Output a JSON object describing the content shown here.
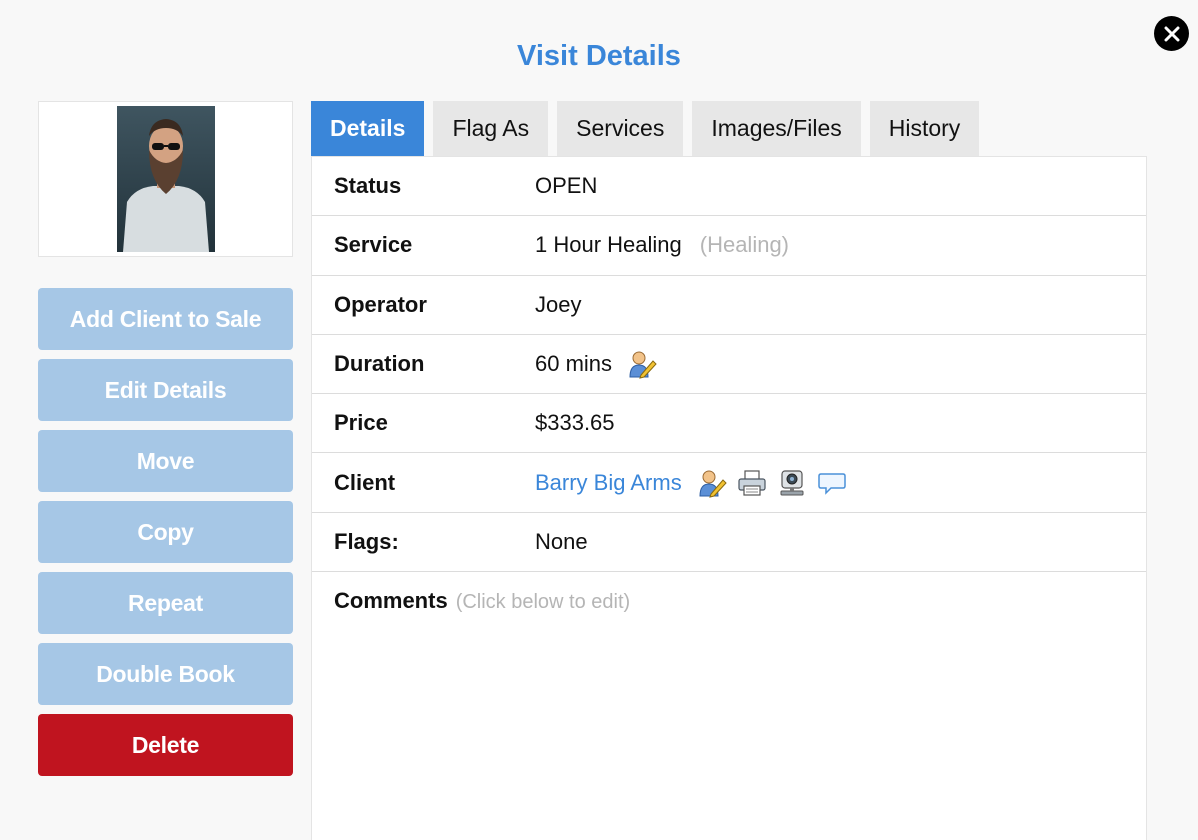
{
  "modal": {
    "title": "Visit Details",
    "close_icon": "close-icon"
  },
  "client_photo": {
    "icon": "client-photo"
  },
  "actions": {
    "add_client_to_sale": "Add Client to Sale",
    "edit_details": "Edit Details",
    "move": "Move",
    "copy": "Copy",
    "repeat": "Repeat",
    "double_book": "Double Book",
    "delete": "Delete"
  },
  "colors": {
    "accent": "#3a86d9",
    "action_button": "#a6c7e6",
    "delete_button": "#c0141f"
  },
  "tabs": [
    {
      "label": "Details",
      "active": true
    },
    {
      "label": "Flag As",
      "active": false
    },
    {
      "label": "Services",
      "active": false
    },
    {
      "label": "Images/Files",
      "active": false
    },
    {
      "label": "History",
      "active": false
    }
  ],
  "details": {
    "status": {
      "label": "Status",
      "value": "OPEN"
    },
    "service": {
      "label": "Service",
      "value": "1 Hour Healing",
      "category": "(Healing)"
    },
    "operator": {
      "label": "Operator",
      "value": "Joey"
    },
    "duration": {
      "label": "Duration",
      "value": "60 mins",
      "icon": "edit-user-icon"
    },
    "price": {
      "label": "Price",
      "value": "$333.65"
    },
    "client": {
      "label": "Client",
      "value": "Barry Big Arms",
      "icons": [
        "edit-user-icon",
        "printer-icon",
        "webcam-icon",
        "chat-bubble-icon"
      ]
    },
    "flags": {
      "label": "Flags:",
      "value": "None"
    },
    "comments": {
      "label": "Comments",
      "hint": "(Click below to edit)"
    }
  }
}
